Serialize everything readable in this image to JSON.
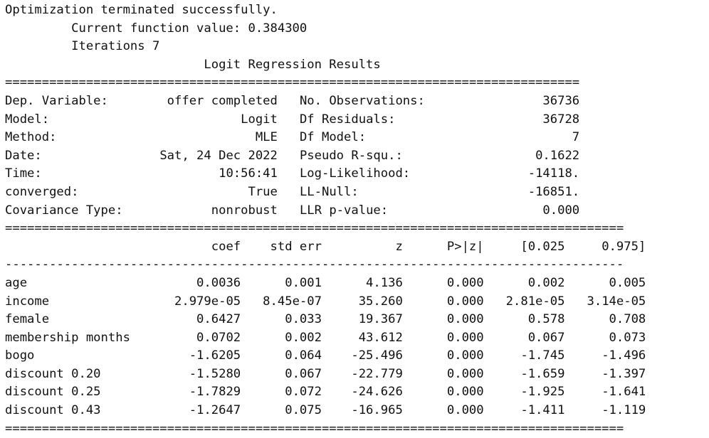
{
  "header": {
    "message": "Optimization terminated successfully.",
    "function_value": "         Current function value: 0.384300",
    "iterations": "         Iterations 7",
    "title": "                           Logit Regression Results"
  },
  "summary": [
    {
      "left_label": "Dep. Variable:",
      "left_value": "offer completed",
      "right_label": "No. Observations:",
      "right_value": "36736"
    },
    {
      "left_label": "Model:",
      "left_value": "Logit",
      "right_label": "Df Residuals:",
      "right_value": "36728"
    },
    {
      "left_label": "Method:",
      "left_value": "MLE",
      "right_label": "Df Model:",
      "right_value": "7"
    },
    {
      "left_label": "Date:",
      "left_value": "Sat, 24 Dec 2022",
      "right_label": "Pseudo R-squ.:",
      "right_value": "0.1622"
    },
    {
      "left_label": "Time:",
      "left_value": "10:56:41",
      "right_label": "Log-Likelihood:",
      "right_value": "-14118."
    },
    {
      "left_label": "converged:",
      "left_value": "True",
      "right_label": "LL-Null:",
      "right_value": "-16851."
    },
    {
      "left_label": "Covariance Type:",
      "left_value": "nonrobust",
      "right_label": "LLR p-value:",
      "right_value": "0.000"
    }
  ],
  "coef_table": {
    "columns": [
      "",
      "coef",
      "std err",
      "z",
      "P>|z|",
      "[0.025",
      "0.975]"
    ],
    "rows": [
      [
        "age",
        "0.0036",
        "0.001",
        "4.136",
        "0.000",
        "0.002",
        "0.005"
      ],
      [
        "income",
        "2.979e-05",
        "8.45e-07",
        "35.260",
        "0.000",
        "2.81e-05",
        "3.14e-05"
      ],
      [
        "female",
        "0.6427",
        "0.033",
        "19.367",
        "0.000",
        "0.578",
        "0.708"
      ],
      [
        "membership months",
        "0.0702",
        "0.002",
        "43.612",
        "0.000",
        "0.067",
        "0.073"
      ],
      [
        "bogo",
        "-1.6205",
        "0.064",
        "-25.496",
        "0.000",
        "-1.745",
        "-1.496"
      ],
      [
        "discount 0.20",
        "-1.5280",
        "0.067",
        "-22.779",
        "0.000",
        "-1.659",
        "-1.397"
      ],
      [
        "discount 0.25",
        "-1.7829",
        "0.072",
        "-24.626",
        "0.000",
        "-1.925",
        "-1.641"
      ],
      [
        "discount 0.43",
        "-1.2647",
        "0.075",
        "-16.965",
        "0.000",
        "-1.411",
        "-1.119"
      ]
    ]
  }
}
